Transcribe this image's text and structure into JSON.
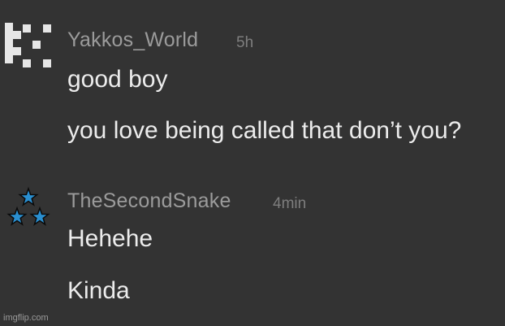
{
  "comments": [
    {
      "username": "Yakkos_World",
      "time": "5h",
      "avatar_icon": "pixel-pattern-avatar-icon",
      "lines": [
        "good boy",
        "you love being called that don’t you?"
      ]
    },
    {
      "username": "TheSecondSnake",
      "time": "4min",
      "avatar_icon": "triple-blue-star-avatar-icon",
      "lines": [
        "Hehehe",
        "Kinda"
      ]
    }
  ],
  "colors": {
    "background": "#333333",
    "username": "#9b9b9b",
    "timestamp": "#7e7e7e",
    "message": "#ececec",
    "star_fill": "#2a8fd0",
    "avatar_pixel": "#e6e6e6"
  },
  "watermark": "imgflip.com"
}
